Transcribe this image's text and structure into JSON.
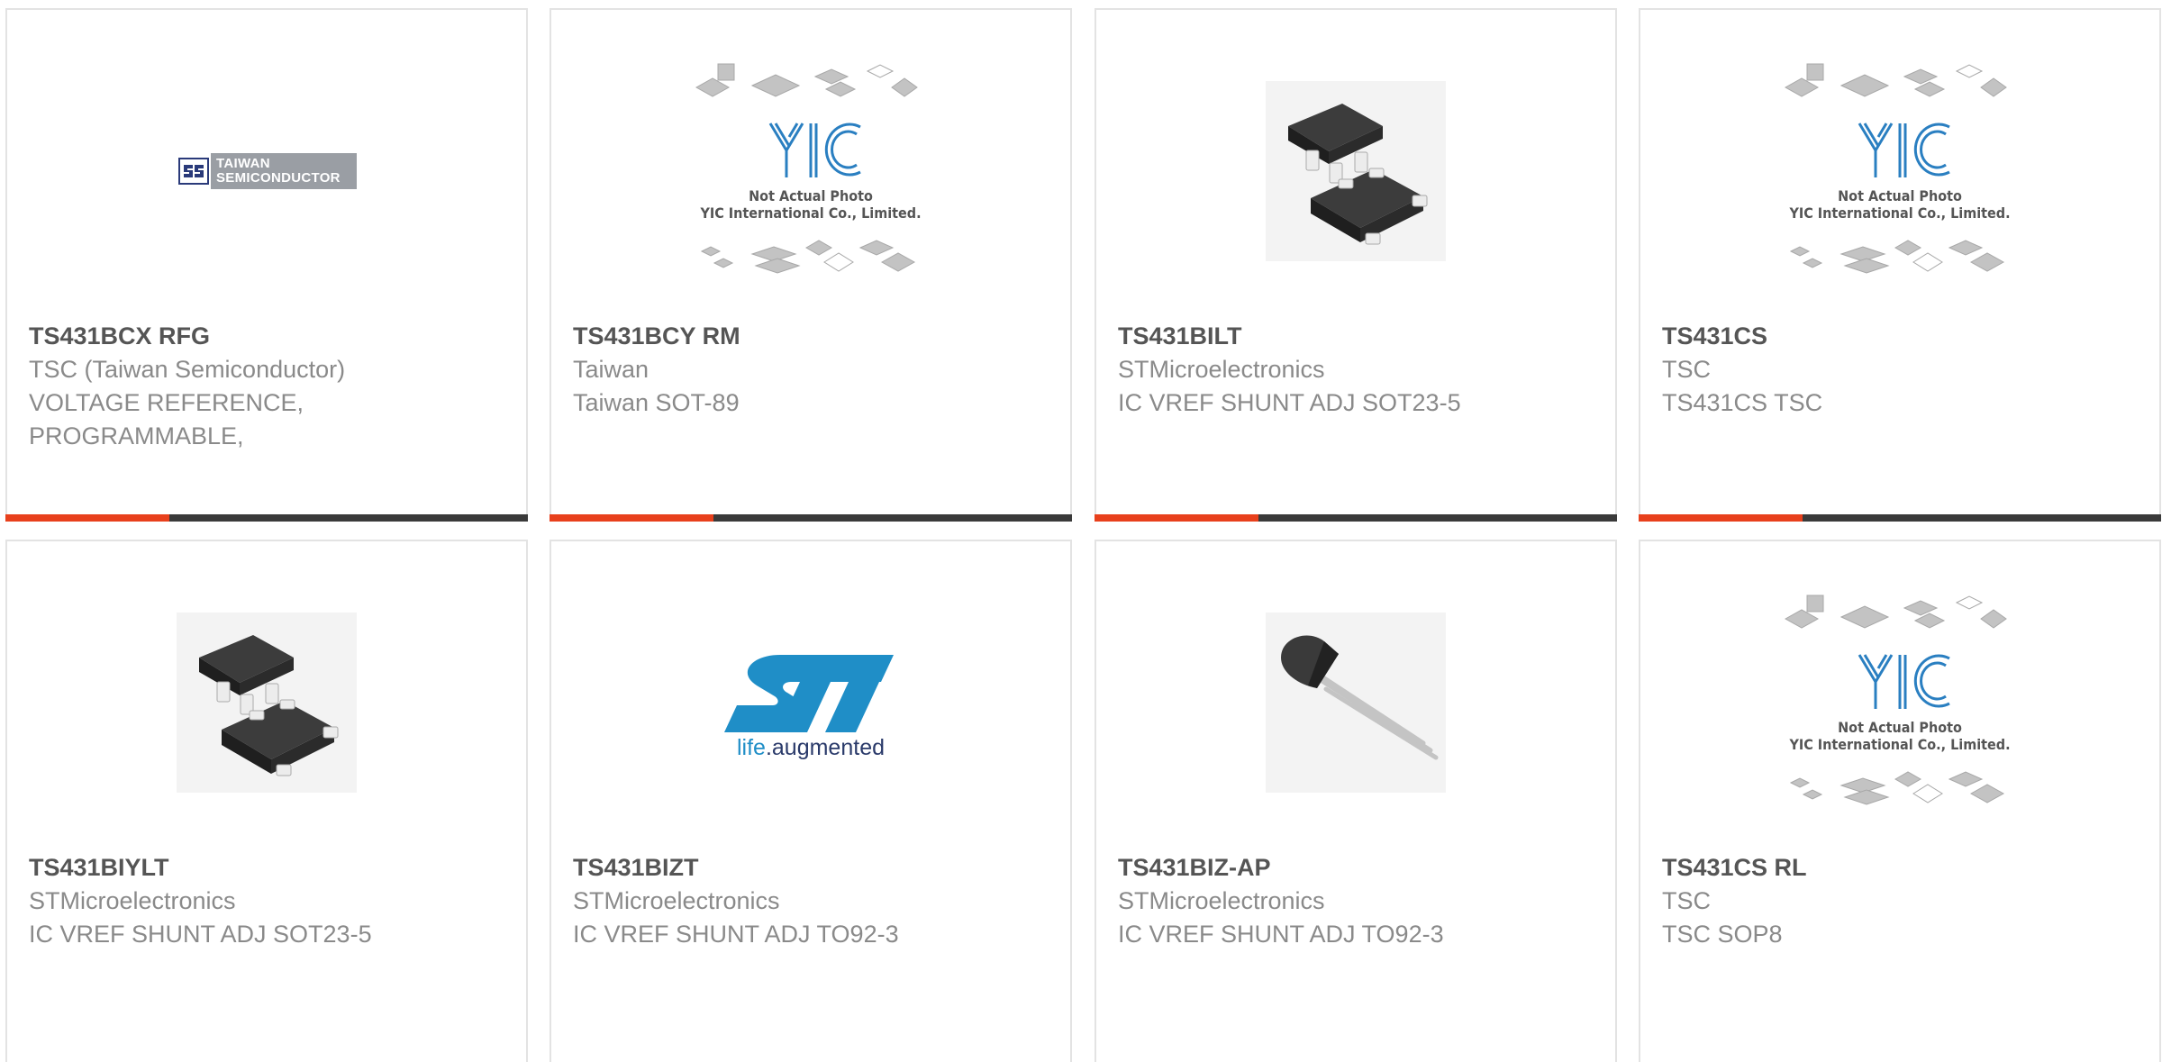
{
  "products": [
    {
      "part": "TS431BCX RFG",
      "maker": "TSC (Taiwan Semiconductor)",
      "desc": "VOLTAGE REFERENCE, PROGRAMMABLE,",
      "image": "taiwan-semiconductor-logo"
    },
    {
      "part": "TS431BCY RM",
      "maker": "Taiwan",
      "desc": "Taiwan SOT-89",
      "image": "yic-placeholder"
    },
    {
      "part": "TS431BILT",
      "maker": "STMicroelectronics",
      "desc": "IC VREF SHUNT ADJ SOT23-5",
      "image": "sot23-5-photo"
    },
    {
      "part": "TS431CS",
      "maker": "TSC",
      "desc": "TS431CS TSC",
      "image": "yic-placeholder"
    },
    {
      "part": "TS431BIYLT",
      "maker": "STMicroelectronics",
      "desc": "IC VREF SHUNT ADJ SOT23-5",
      "image": "sot23-5-photo"
    },
    {
      "part": "TS431BIZT",
      "maker": "STMicroelectronics",
      "desc": "IC VREF SHUNT ADJ TO92-3",
      "image": "st-logo"
    },
    {
      "part": "TS431BIZ-AP",
      "maker": "STMicroelectronics",
      "desc": "IC VREF SHUNT ADJ TO92-3",
      "image": "to92-photo"
    },
    {
      "part": "TS431CS RL",
      "maker": "TSC",
      "desc": "TSC SOP8",
      "image": "yic-placeholder"
    }
  ],
  "logos": {
    "tsc_line1": "TAIWAN",
    "tsc_line2": "SEMICONDUCTOR",
    "yic_line1": "Not Actual Photo",
    "yic_line2": "YIC International Co., Limited.",
    "st_tagline_a": "life",
    "st_tagline_b": ".augmented"
  },
  "colors": {
    "accent": "#e8401c",
    "bar": "#3a3a3a",
    "st_blue": "#1f8ec7",
    "yic_blue": "#2a7fc1"
  }
}
